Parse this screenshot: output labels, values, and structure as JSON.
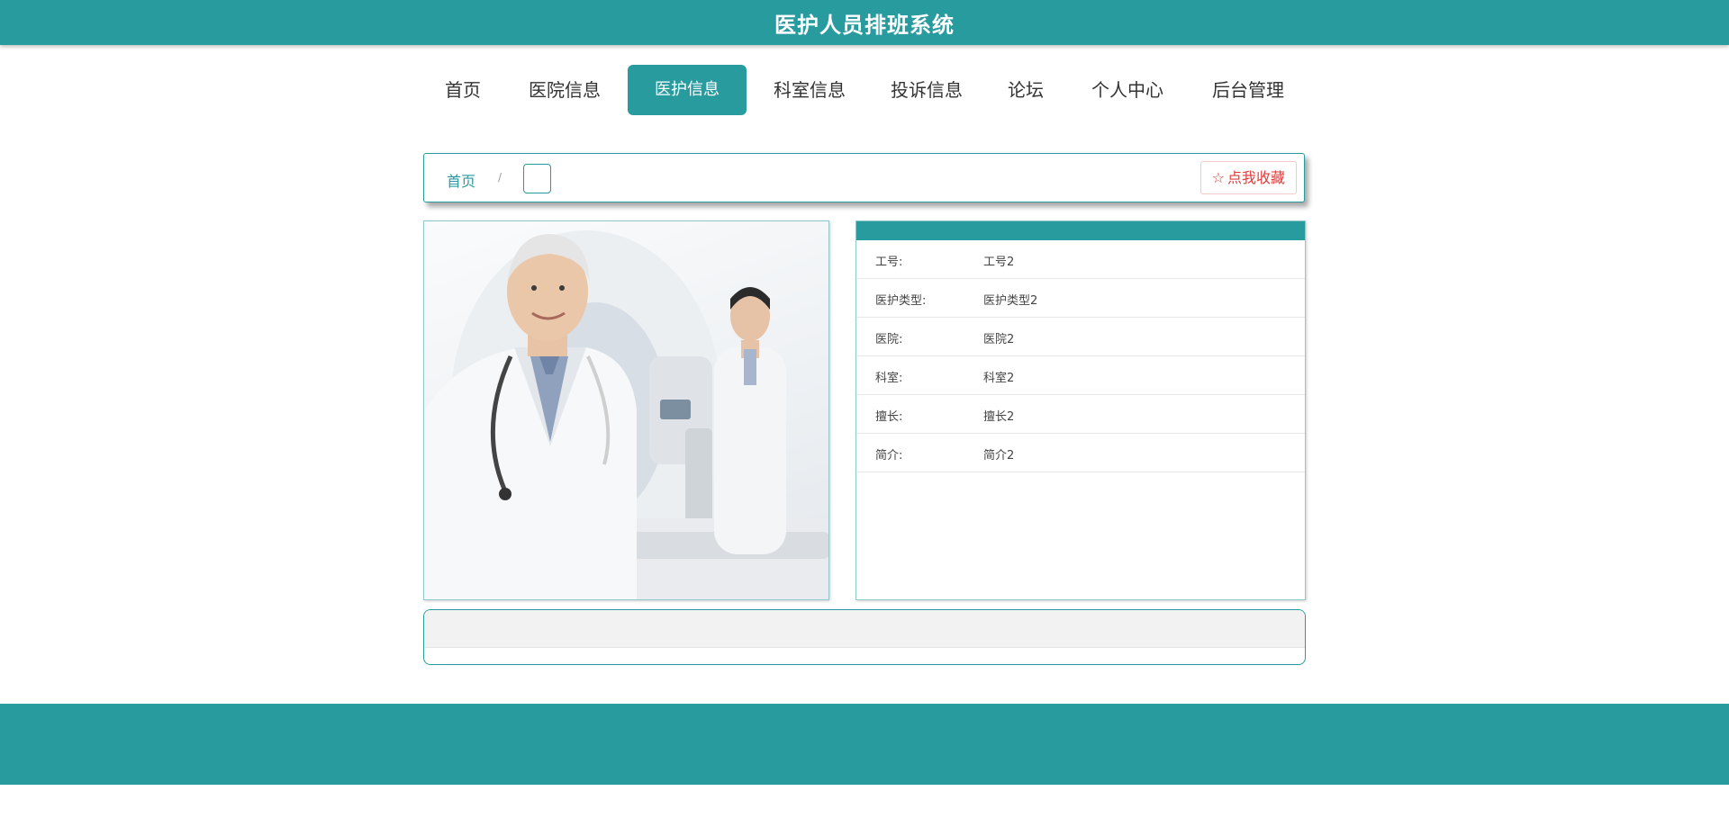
{
  "header": {
    "title": "医护人员排班系统"
  },
  "nav": {
    "items": [
      {
        "label": "首页"
      },
      {
        "label": "医院信息"
      },
      {
        "label": "医护信息",
        "active": true
      },
      {
        "label": "科室信息"
      },
      {
        "label": "投诉信息"
      },
      {
        "label": "论坛"
      },
      {
        "label": "个人中心"
      },
      {
        "label": "后台管理"
      }
    ]
  },
  "breadcrumb": {
    "home": "首页",
    "separator": "/"
  },
  "favorite": {
    "icon": "star-outline-icon",
    "label": "点我收藏"
  },
  "details": {
    "rows": [
      {
        "label": "工号:",
        "value": "工号2"
      },
      {
        "label": "医护类型:",
        "value": "医护类型2"
      },
      {
        "label": "医院:",
        "value": "医院2"
      },
      {
        "label": "科室:",
        "value": "科室2"
      },
      {
        "label": "擅长:",
        "value": "擅长2"
      },
      {
        "label": "简介:",
        "value": "简介2"
      }
    ]
  },
  "colors": {
    "primary": "#289b9f",
    "favorite": "#e23b3b"
  }
}
